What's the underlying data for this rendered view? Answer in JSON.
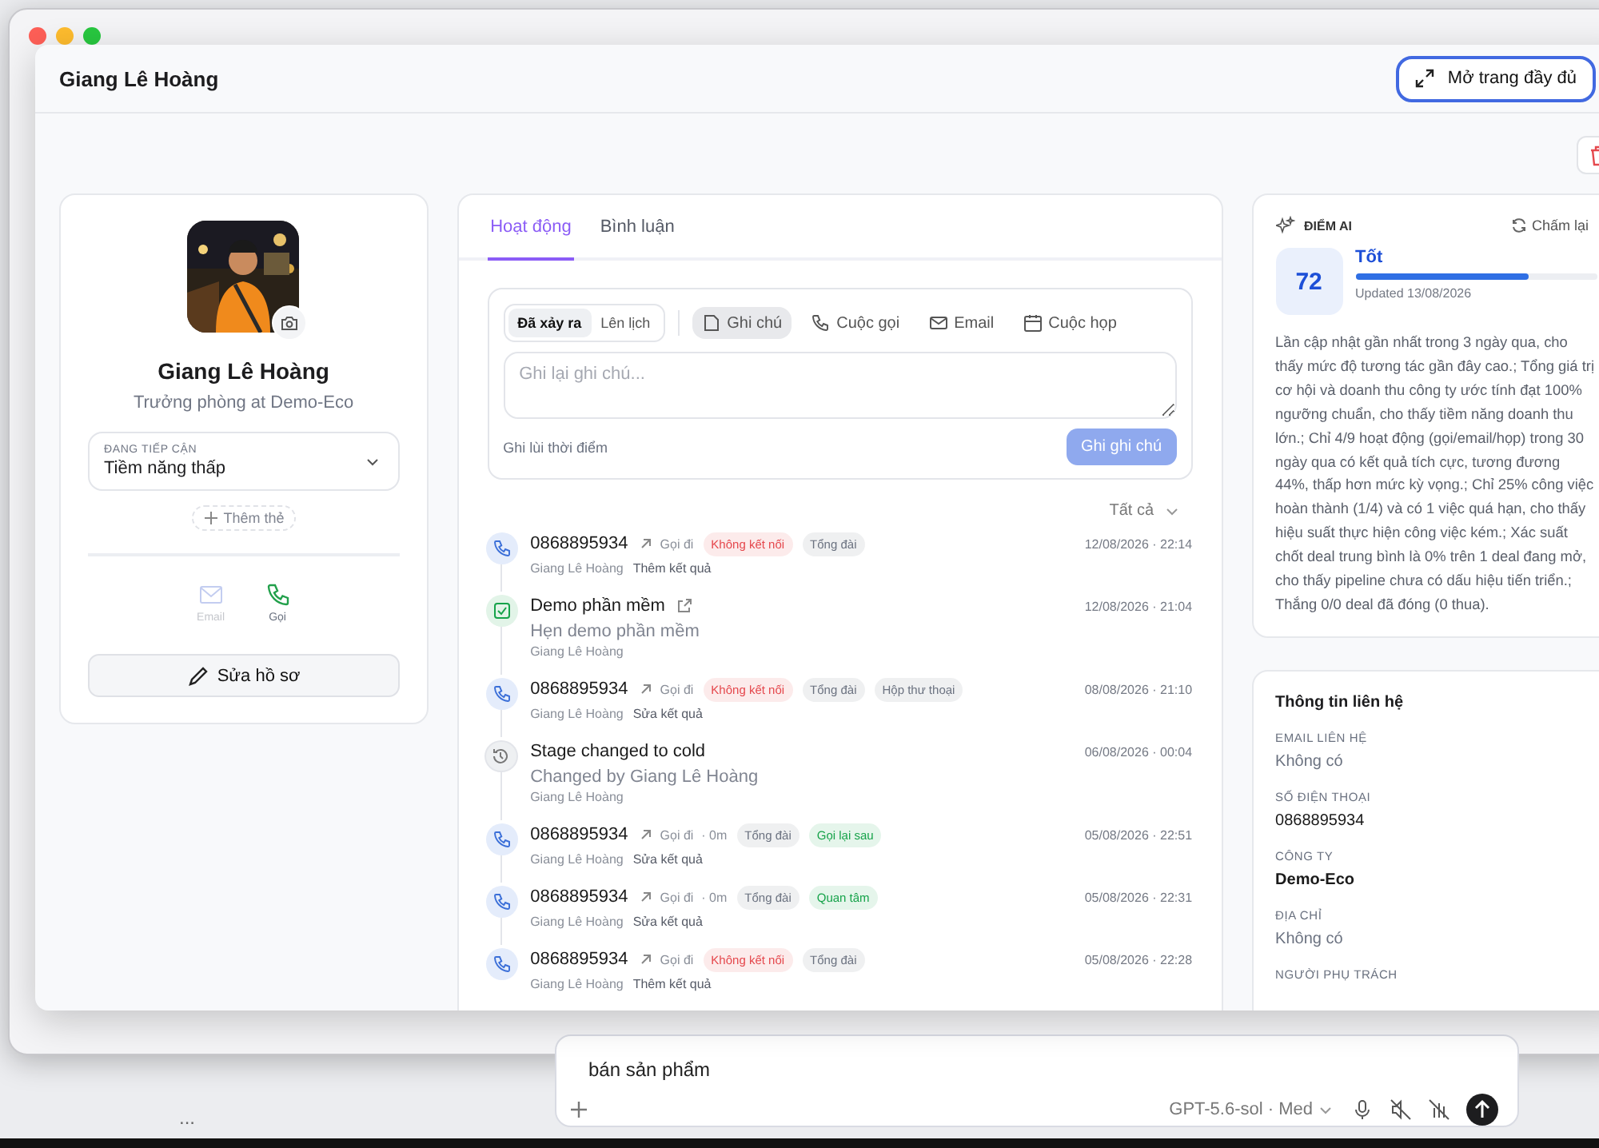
{
  "backdrop": {
    "ellipsis": "...",
    "composer": {
      "text": "bán sản phẩm",
      "model": "GPT-5.6-sol · Med"
    }
  },
  "panel": {
    "title": "Giang Lê Hoàng",
    "open_full_button": "Mở trang đầy đủ"
  },
  "profile": {
    "name": "Giang Lê Hoàng",
    "job": "Trưởng phòng at Demo-Eco",
    "stage": {
      "label": "ĐANG TIẾP CẬN",
      "value": "Tiềm năng thấp"
    },
    "add_tag": "Thêm thẻ",
    "actions": [
      {
        "kind": "email",
        "label": "Email",
        "disabled": true
      },
      {
        "kind": "call",
        "label": "Gọi",
        "disabled": false
      }
    ],
    "edit_button": "Sửa hồ sơ"
  },
  "activity": {
    "tabs": [
      {
        "label": "Hoạt động",
        "selected": true
      },
      {
        "label": "Bình luận",
        "selected": false
      }
    ],
    "modes": [
      {
        "label": "Đã xảy ra",
        "selected": true
      },
      {
        "label": "Lên lịch",
        "selected": false
      }
    ],
    "types": [
      {
        "kind": "note",
        "label": "Ghi chú",
        "selected": true
      },
      {
        "kind": "call",
        "label": "Cuộc gọi",
        "selected": false
      },
      {
        "kind": "email",
        "label": "Email",
        "selected": false
      },
      {
        "kind": "meeting",
        "label": "Cuộc họp",
        "selected": false
      }
    ],
    "placeholder": "Ghi lại ghi chú...",
    "backdate": "Ghi lùi thời điểm",
    "submit": {
      "label": "Ghi ghi chú",
      "disabled": true
    },
    "filter": "Tất cả",
    "items": [
      {
        "kind": "call",
        "title": "0868895934",
        "direction": "Gọi đi",
        "tags": [
          {
            "label": "Không kết nối",
            "color": "#e5484d"
          },
          {
            "label": "Tổng đài",
            "color": "#6b7280"
          }
        ],
        "user": "Giang Lê Hoàng",
        "action": "Thêm kết quả",
        "time": "12/08/2026 · 22:14"
      },
      {
        "kind": "task",
        "title": "Demo phần mềm",
        "subtitle": "Hẹn demo phần mềm",
        "user": "Giang Lê Hoàng",
        "time": "12/08/2026 · 21:04"
      },
      {
        "kind": "call",
        "title": "0868895934",
        "direction": "Gọi đi",
        "tags": [
          {
            "label": "Không kết nối",
            "color": "#e5484d"
          },
          {
            "label": "Tổng đài",
            "color": "#6b7280"
          },
          {
            "label": "Hộp thư thoại",
            "color": "#6b7280"
          }
        ],
        "user": "Giang Lê Hoàng",
        "action": "Sửa kết quả",
        "time": "08/08/2026 · 21:10"
      },
      {
        "kind": "stage",
        "title": "Stage changed to cold",
        "subtitle": "Changed by Giang Lê Hoàng",
        "user": "Giang Lê Hoàng",
        "time": "06/08/2026 · 00:04"
      },
      {
        "kind": "call",
        "title": "0868895934",
        "direction": "Gọi đi",
        "duration": "· 0m",
        "tags": [
          {
            "label": "Tổng đài",
            "color": "#6b7280"
          },
          {
            "label": "Gọi lại sau",
            "color": "#16a34a"
          }
        ],
        "user": "Giang Lê Hoàng",
        "action": "Sửa kết quả",
        "time": "05/08/2026 · 22:51"
      },
      {
        "kind": "call",
        "title": "0868895934",
        "direction": "Gọi đi",
        "duration": "· 0m",
        "tags": [
          {
            "label": "Tổng đài",
            "color": "#6b7280"
          },
          {
            "label": "Quan tâm",
            "color": "#16a34a"
          }
        ],
        "user": "Giang Lê Hoàng",
        "action": "Sửa kết quả",
        "time": "05/08/2026 · 22:31"
      },
      {
        "kind": "call",
        "title": "0868895934",
        "direction": "Gọi đi",
        "tags": [
          {
            "label": "Không kết nối",
            "color": "#e5484d"
          },
          {
            "label": "Tổng đài",
            "color": "#6b7280"
          }
        ],
        "user": "Giang Lê Hoàng",
        "action": "Thêm kết quả",
        "time": "05/08/2026 · 22:28"
      }
    ]
  },
  "ai_score": {
    "label": "ĐIỂM AI",
    "rescore": "Chấm lại",
    "score": "72",
    "rating": "Tốt",
    "level": 0.72,
    "updated": "Updated 13/08/2026",
    "summary": "Lần cập nhật gần nhất trong 3 ngày qua, cho thấy mức độ tương tác gần đây cao.; Tổng giá trị cơ hội và doanh thu công ty ước tính đạt 100% ngưỡng chuẩn, cho thấy tiềm năng doanh thu lớn.; Chỉ 4/9 hoạt động (gọi/email/họp) trong 30 ngày qua có kết quả tích cực, tương đương 44%, thấp hơn mức kỳ vọng.; Chỉ 25% công việc hoàn thành (1/4) và có 1 việc quá hạn, cho thấy hiệu suất thực hiện công việc kém.; Xác suất chốt deal trung bình là 0% trên 1 deal đang mở, cho thấy pipeline chưa có dấu hiệu tiến triển.; Thắng 0/0 deal đã đóng (0 thua)."
  },
  "contact_info": {
    "title": "Thông tin liên hệ",
    "fields": [
      {
        "label": "EMAIL LIÊN HỆ",
        "value": "Không có",
        "empty": true
      },
      {
        "label": "SỐ ĐIỆN THOẠI",
        "value": "0868895934",
        "empty": false
      },
      {
        "label": "CÔNG TY",
        "value": "Demo-Eco",
        "empty": false,
        "bold": true
      },
      {
        "label": "ĐỊA CHỈ",
        "value": "Không có",
        "empty": true
      },
      {
        "label": "NGƯỜI PHỤ TRÁCH"
      }
    ]
  }
}
